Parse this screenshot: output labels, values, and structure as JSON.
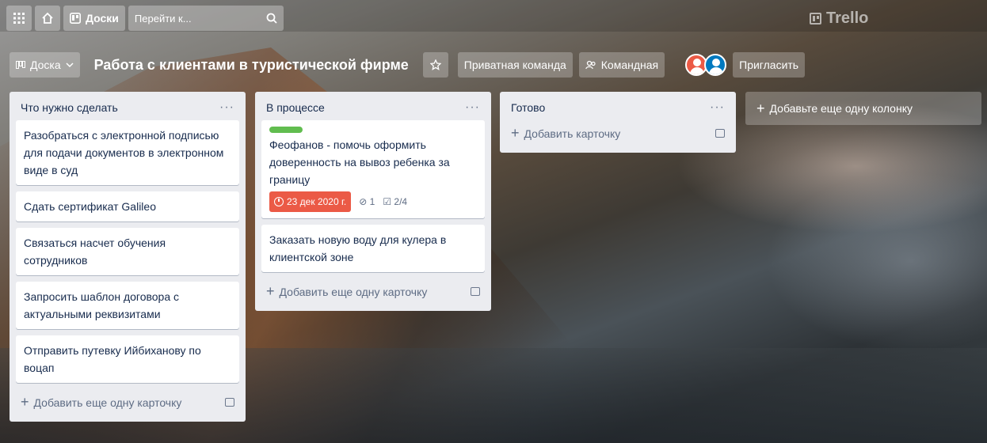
{
  "topbar": {
    "apps_icon": "grid-icon",
    "home_icon": "home-icon",
    "boards_label": "Доски",
    "search_placeholder": "Перейти к...",
    "logo_text": "Trello"
  },
  "boardbar": {
    "view_label": "Доска",
    "title": "Работа с клиентами в туристической фирме",
    "team_label": "Приватная команда",
    "visibility_label": "Командная",
    "invite_label": "Пригласить"
  },
  "lists": [
    {
      "title": "Что нужно сделать",
      "cards": [
        {
          "text": "Разобраться с электронной подписью для подачи документов в электронном виде в суд"
        },
        {
          "text": "Сдать сертификат Galileo"
        },
        {
          "text": "Связаться насчет обучения сотрудников"
        },
        {
          "text": "Запросить шаблон договора с актуальными реквизитами"
        },
        {
          "text": "Отправить путевку Ийбиханову по воцап"
        }
      ],
      "add_label": "Добавить еще одну карточку"
    },
    {
      "title": "В процессе",
      "cards": [
        {
          "text": "Феофанов - помочь оформить доверенность на вывоз ребенка за границу",
          "due": "23 дек 2020 г.",
          "attachments": "1",
          "checklist": "2/4",
          "label_color": "#61bd4f"
        },
        {
          "text": "Заказать новую воду для кулера в клиентской зоне"
        }
      ],
      "add_label": "Добавить еще одну карточку"
    },
    {
      "title": "Готово",
      "cards": [],
      "add_label": "Добавить карточку"
    }
  ],
  "add_column_label": "Добавьте еще одну колонку",
  "colors": {
    "list_bg": "#ebecf0",
    "due_overdue": "#eb5a46",
    "label_green": "#61bd4f"
  }
}
